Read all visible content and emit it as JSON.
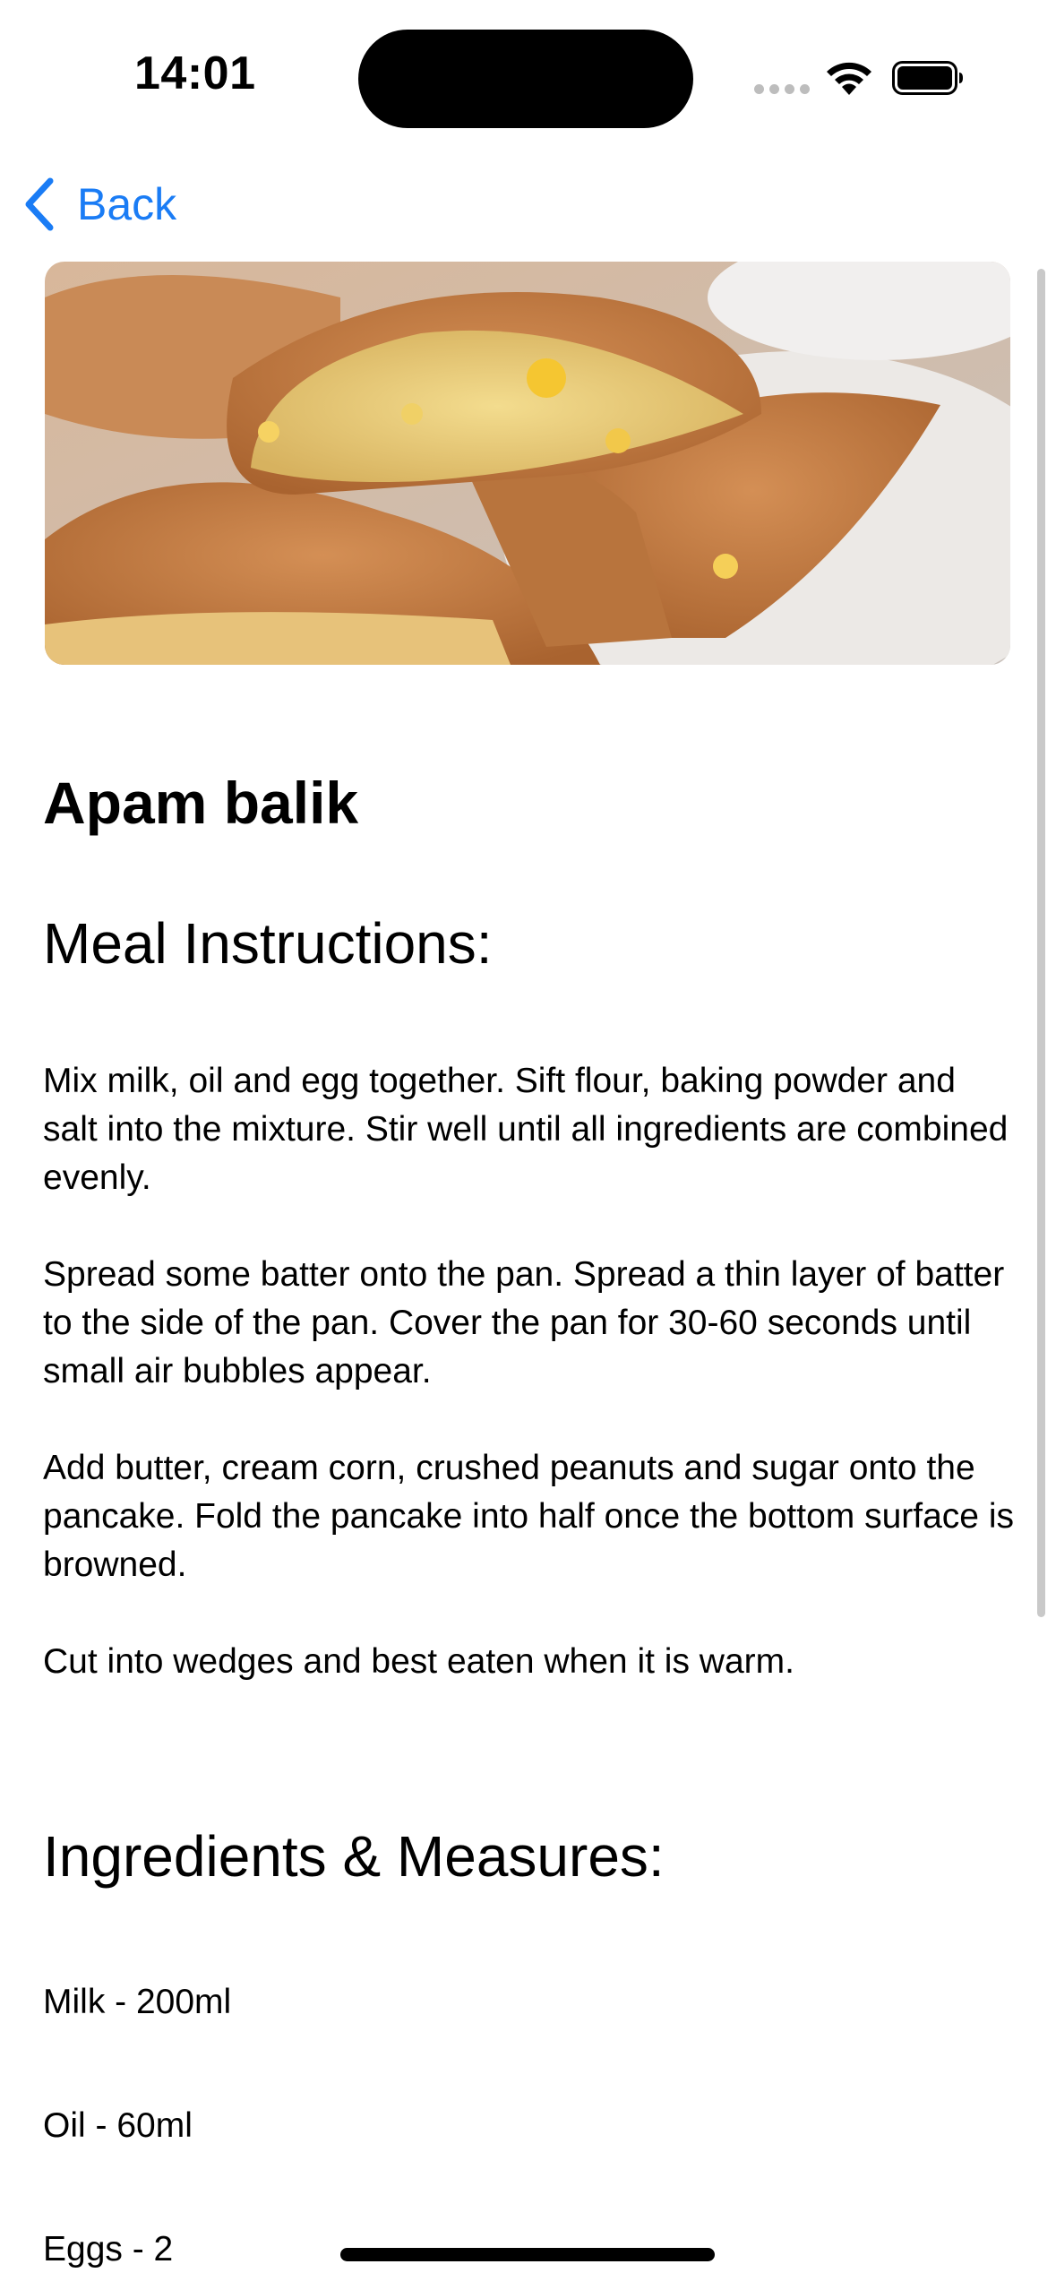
{
  "status_bar": {
    "time": "14:01"
  },
  "nav": {
    "back_label": "Back"
  },
  "meal": {
    "title": "Apam balik",
    "instructions_heading": "Meal Instructions:",
    "instructions": [
      "Mix milk, oil and egg together. Sift flour, baking powder and salt into the mixture. Stir well until all ingredients are combined evenly.",
      "Spread some batter onto the pan. Spread a thin layer of batter to the side of the pan. Cover the pan for 30-60 seconds until small air bubbles appear.",
      "Add butter, cream corn, crushed peanuts and sugar onto the pancake. Fold the pancake into half once the bottom surface is browned.",
      "Cut into wedges and best eaten when it is warm."
    ],
    "ingredients_heading": "Ingredients & Measures:",
    "ingredients": [
      "Milk - 200ml",
      "Oil - 60ml",
      "Eggs - 2"
    ]
  },
  "colors": {
    "accent": "#1a7cf5",
    "text": "#000000",
    "background": "#ffffff"
  },
  "icons": {
    "back": "chevron-left-icon",
    "wifi": "wifi-icon",
    "battery": "battery-icon",
    "signal": "cellular-signal-icon"
  }
}
